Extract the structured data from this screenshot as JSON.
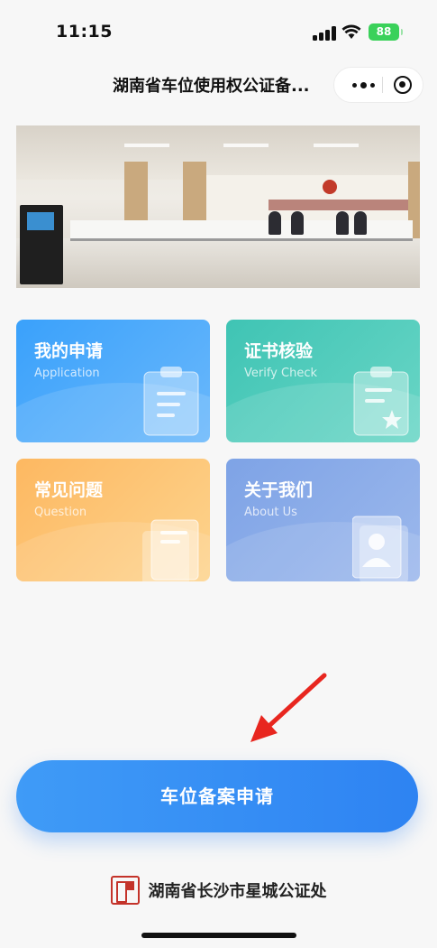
{
  "status_bar": {
    "time": "11:15",
    "battery": "88"
  },
  "nav": {
    "title": "湖南省车位使用权公证备...",
    "more_icon": "more-dots-icon",
    "close_icon": "target-close-icon"
  },
  "banner": {
    "description": "service-hall-photo"
  },
  "tiles": [
    {
      "title": "我的申请",
      "subtitle": "Application",
      "icon": "clipboard-list-icon",
      "color": "#3aa1fb"
    },
    {
      "title": "证书核验",
      "subtitle": "Verify Check",
      "icon": "clipboard-star-icon",
      "color": "#3fc4b4"
    },
    {
      "title": "常见问题",
      "subtitle": "Question",
      "icon": "document-icon",
      "color": "#fdb861"
    },
    {
      "title": "关于我们",
      "subtitle": "About Us",
      "icon": "person-card-icon",
      "color": "#7ea3e6"
    }
  ],
  "primary_button": {
    "label": "车位备案申请"
  },
  "footer": {
    "org_name": "湖南省长沙市星城公证处",
    "logo_icon": "notary-seal-icon"
  },
  "accent_color": "#2e83f2"
}
